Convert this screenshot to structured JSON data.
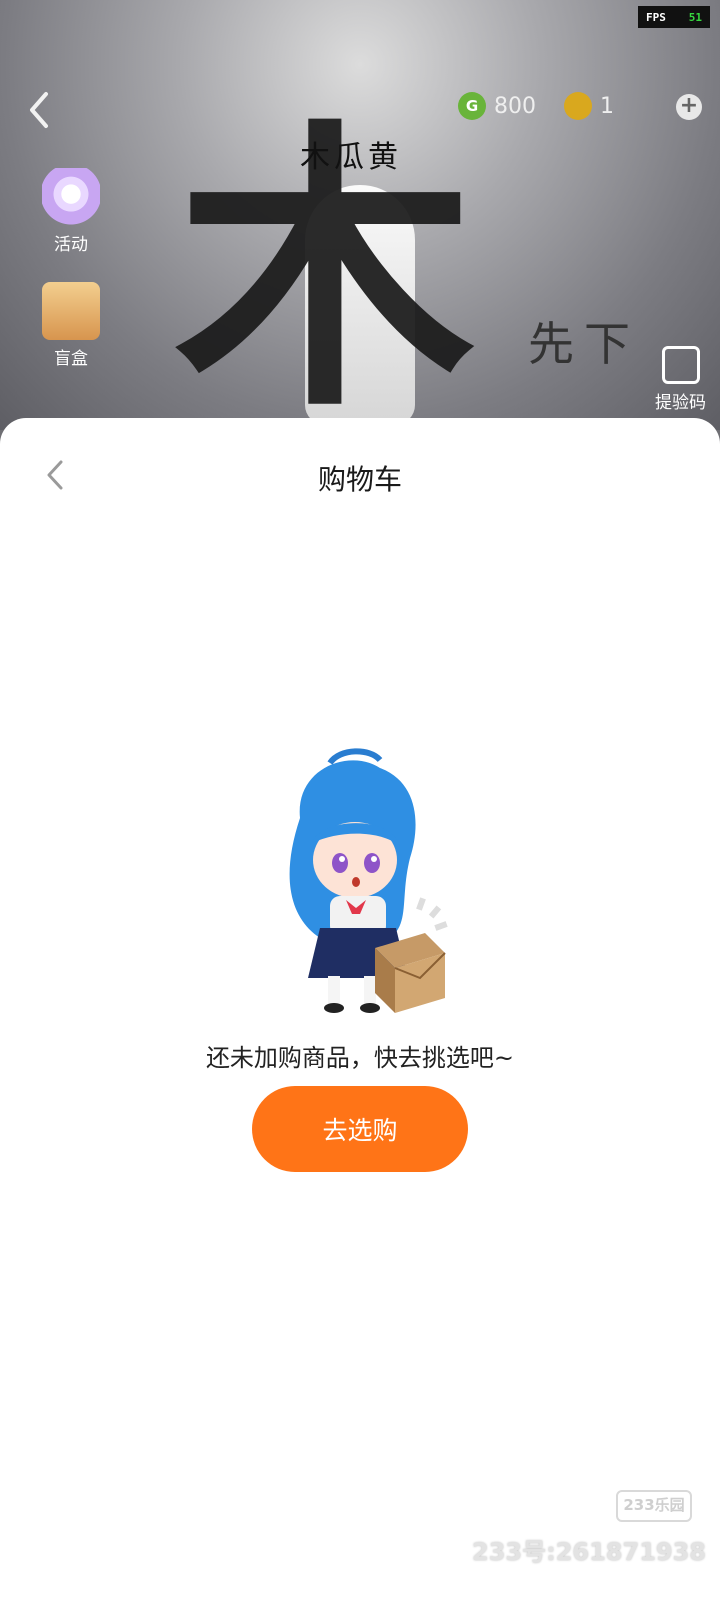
{
  "game": {
    "fps_label": "FPS",
    "fps_value": "51",
    "currency_green_symbol": "G",
    "currency_green_amount": "800",
    "currency_gold_amount": "1",
    "plus_symbol": "+",
    "side_activity_label": "活动",
    "side_blindbox_label": "盲盒",
    "side_code_label": "提验码",
    "calligraphy_main": "木",
    "calligraphy_small": "木瓜黄",
    "calligraphy_right": "先下"
  },
  "cart": {
    "title": "购物车",
    "empty_message": "还未加购商品，快去挑选吧~",
    "shop_button_label": "去选购"
  },
  "watermark": {
    "logo": "233乐园",
    "text": "233号:261871938"
  },
  "colors": {
    "accent": "#ff7417",
    "sheet_bg": "#ffffff"
  }
}
